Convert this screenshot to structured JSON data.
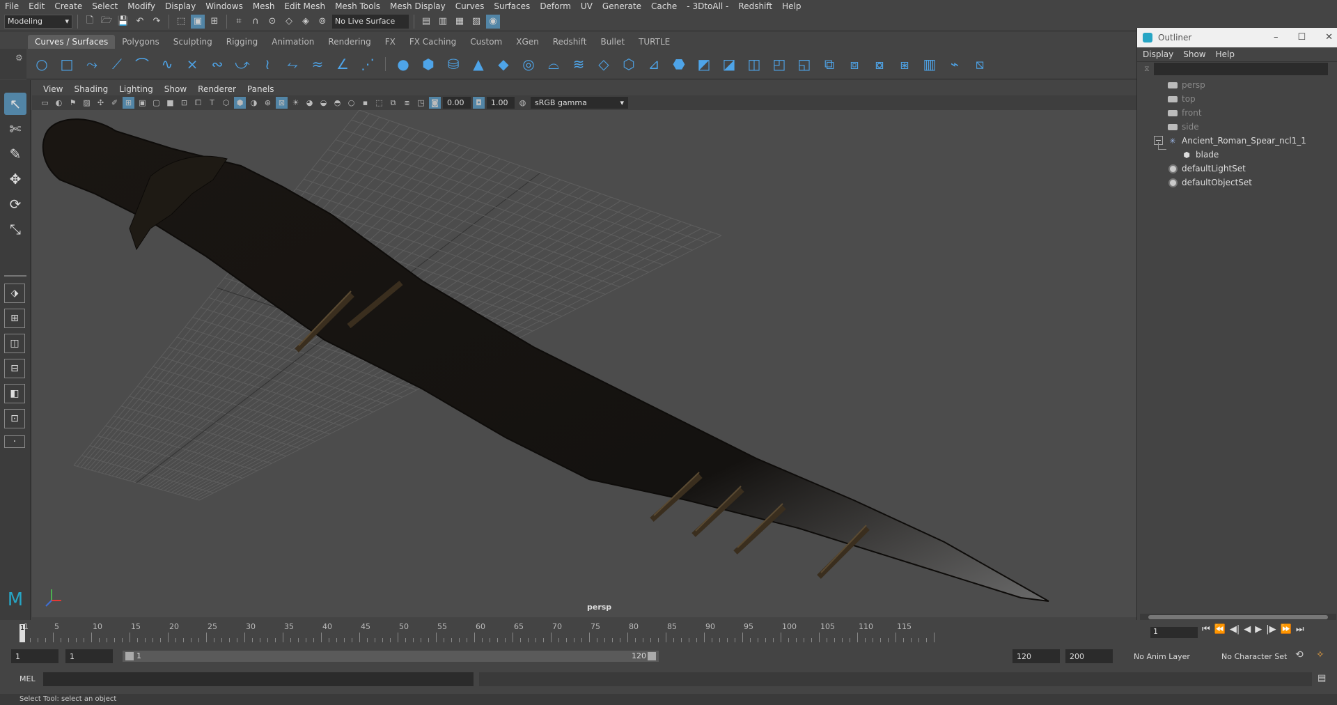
{
  "menubar": [
    "File",
    "Edit",
    "Create",
    "Select",
    "Modify",
    "Display",
    "Windows",
    "Mesh",
    "Edit Mesh",
    "Mesh Tools",
    "Mesh Display",
    "Curves",
    "Surfaces",
    "Deform",
    "UV",
    "Generate",
    "Cache",
    "- 3DtoAll -",
    "Redshift",
    "Help"
  ],
  "statusline": {
    "mode": "Modeling",
    "live_surface": "No Live Surface"
  },
  "shelf": {
    "tabs": [
      "Curves / Surfaces",
      "Polygons",
      "Sculpting",
      "Rigging",
      "Animation",
      "Rendering",
      "FX",
      "FX Caching",
      "Custom",
      "XGen",
      "Redshift",
      "Bullet",
      "TURTLE"
    ],
    "active_tab": "Curves / Surfaces"
  },
  "panel": {
    "menu": [
      "View",
      "Shading",
      "Lighting",
      "Show",
      "Renderer",
      "Panels"
    ],
    "exposure": "0.00",
    "gamma": "1.00",
    "color_space": "sRGB gamma",
    "camera_label": "persp"
  },
  "outliner": {
    "title": "Outliner",
    "menu": [
      "Display",
      "Show",
      "Help"
    ],
    "nodes": [
      {
        "label": "persp",
        "type": "camera",
        "dim": true
      },
      {
        "label": "top",
        "type": "camera",
        "dim": true
      },
      {
        "label": "front",
        "type": "camera",
        "dim": true
      },
      {
        "label": "side",
        "type": "camera",
        "dim": true
      },
      {
        "label": "Ancient_Roman_Spear_ncl1_1",
        "type": "group",
        "dim": false
      },
      {
        "label": "blade",
        "type": "mesh",
        "dim": false
      },
      {
        "label": "defaultLightSet",
        "type": "set",
        "dim": false
      },
      {
        "label": "defaultObjectSet",
        "type": "set",
        "dim": false
      }
    ]
  },
  "timeslider": {
    "labels": [
      "1",
      "5",
      "10",
      "15",
      "20",
      "25",
      "30",
      "35",
      "40",
      "45",
      "50",
      "55",
      "60",
      "65",
      "70",
      "75",
      "80",
      "85",
      "90",
      "95",
      "100",
      "105",
      "110",
      "115"
    ],
    "current_frame": "1"
  },
  "range": {
    "start": "1",
    "playback_start": "1",
    "range_start_label": "1",
    "range_end_label": "120",
    "playback_end": "120",
    "end": "200",
    "anim_layer": "No Anim Layer",
    "character_set": "No Character Set"
  },
  "cmdline": {
    "lang": "MEL"
  },
  "helpline": "Select Tool: select an object",
  "colors": {
    "accent": "#5285a6",
    "shelf_icon": "#4ea4e8",
    "outliner_logo": "#27a5c4"
  }
}
